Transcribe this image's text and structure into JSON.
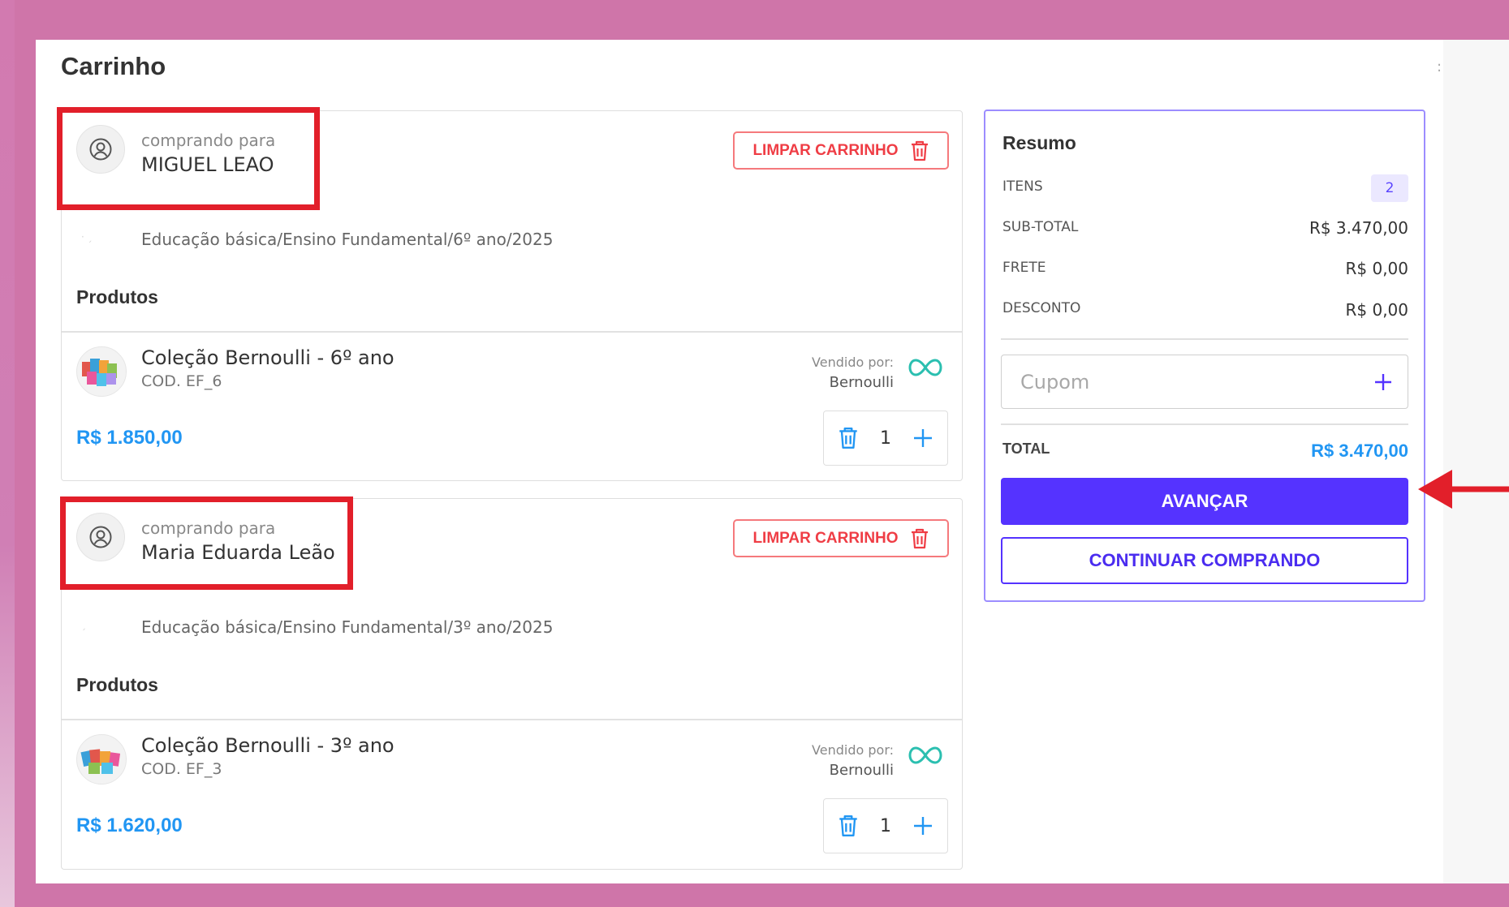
{
  "page": {
    "title": "Carrinho",
    "kebab": ":"
  },
  "carts": [
    {
      "buyer_caption": "comprando para",
      "buyer_name": "MIGUEL LEAO",
      "clear_label": "LIMPAR CARRINHO",
      "segment": "Educação básica/Ensino Fundamental/6º ano/2025",
      "products_heading": "Produtos",
      "product": {
        "name": "Coleção Bernoulli - 6º ano",
        "code": "COD. EF_6",
        "price": "R$ 1.850,00",
        "sold_by_label": "Vendido por:",
        "seller": "Bernoulli",
        "quantity": "1"
      }
    },
    {
      "buyer_caption": "comprando para",
      "buyer_name": "Maria Eduarda Leão",
      "clear_label": "LIMPAR CARRINHO",
      "segment": "Educação básica/Ensino Fundamental/3º ano/2025",
      "products_heading": "Produtos",
      "product": {
        "name": "Coleção Bernoulli - 3º ano",
        "code": "COD. EF_3",
        "price": "R$ 1.620,00",
        "sold_by_label": "Vendido por:",
        "seller": "Bernoulli",
        "quantity": "1"
      }
    }
  ],
  "summary": {
    "title": "Resumo",
    "items_label": "ITENS",
    "items_count": "2",
    "subtotal_label": "SUB-TOTAL",
    "subtotal_value": "R$ 3.470,00",
    "shipping_label": "FRETE",
    "shipping_value": "R$ 0,00",
    "discount_label": "DESCONTO",
    "discount_value": "R$ 0,00",
    "coupon_placeholder": "Cupom",
    "total_label": "TOTAL",
    "total_value": "R$ 3.470,00",
    "advance_label": "AVANÇAR",
    "continue_label": "CONTINUAR COMPRANDO"
  },
  "colors": {
    "frame_background": "#cf75a9",
    "accent_purple": "#5533ff",
    "price_blue": "#2196f3",
    "danger_red": "#ef3d45",
    "annotation_red": "#e21f2a",
    "seller_logo_teal": "#2bbfb0"
  },
  "icons": {
    "avatar": "user-circle-icon",
    "clear": "trash-icon",
    "qty_remove": "trash-icon",
    "qty_add": "plus-icon",
    "coupon_add": "plus-icon",
    "seller_logo": "infinity-icon"
  }
}
